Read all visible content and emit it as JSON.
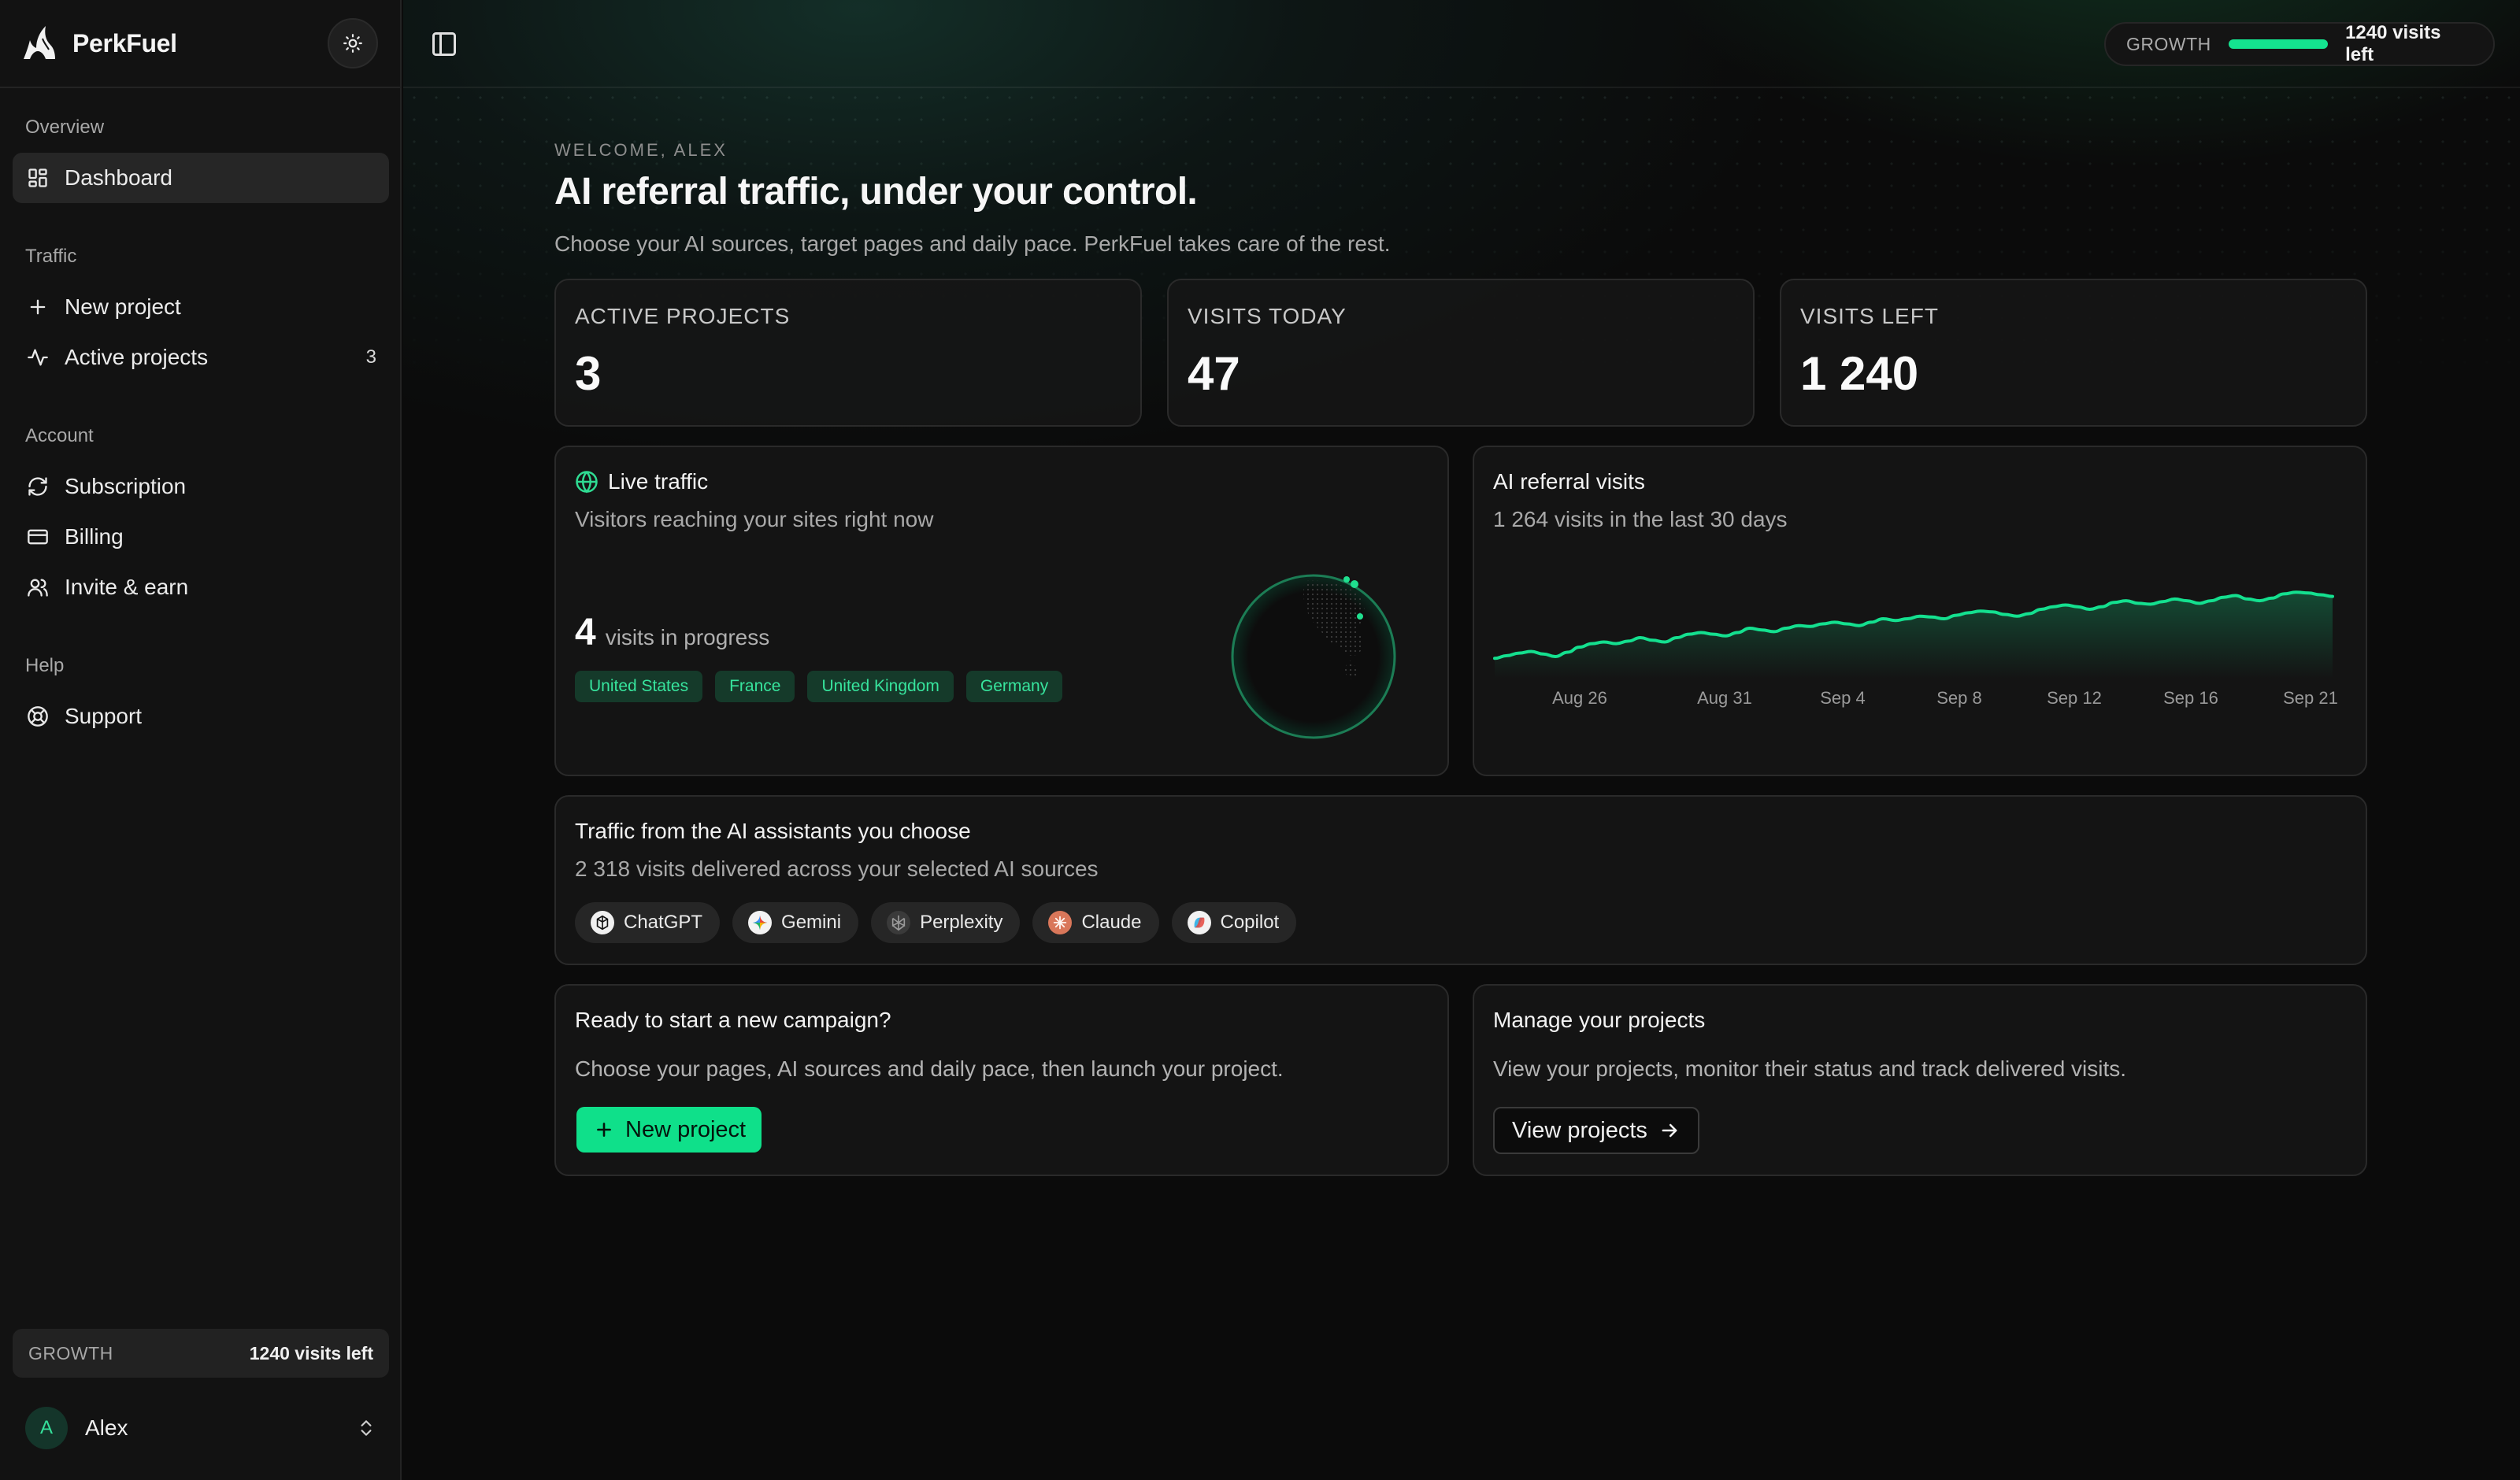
{
  "brand": {
    "name": "PerkFuel"
  },
  "sidebar": {
    "sections": [
      {
        "title": "Overview",
        "items": [
          {
            "label": "Dashboard",
            "icon": "dashboard-icon",
            "active": true
          }
        ]
      },
      {
        "title": "Traffic",
        "items": [
          {
            "label": "New project",
            "icon": "plus-icon"
          },
          {
            "label": "Active projects",
            "icon": "activity-icon",
            "count": "3"
          }
        ]
      },
      {
        "title": "Account",
        "items": [
          {
            "label": "Subscription",
            "icon": "refresh-icon"
          },
          {
            "label": "Billing",
            "icon": "credit-card-icon"
          },
          {
            "label": "Invite & earn",
            "icon": "users-icon"
          }
        ]
      },
      {
        "title": "Help",
        "items": [
          {
            "label": "Support",
            "icon": "lifebuoy-icon"
          }
        ]
      }
    ],
    "plan": {
      "name": "GROWTH",
      "visits_left": "1240 visits left"
    },
    "user": {
      "initial": "A",
      "name": "Alex"
    }
  },
  "topbar": {
    "plan": "GROWTH",
    "visits_left": "1240 visits left",
    "usage_fraction": 1.0
  },
  "welcome": {
    "eyebrow": "WELCOME, ALEX",
    "title": "AI referral traffic, under your control.",
    "subtitle": "Choose your AI sources, target pages and daily pace. PerkFuel takes care of the rest."
  },
  "stats": [
    {
      "label": "ACTIVE PROJECTS",
      "value": "3"
    },
    {
      "label": "VISITS TODAY",
      "value": "47"
    },
    {
      "label": "VISITS LEFT",
      "value": "1 240"
    }
  ],
  "live": {
    "title": "Live traffic",
    "subtitle": "Visitors reaching your sites right now",
    "count": "4",
    "count_label": "visits in progress",
    "countries": [
      "United States",
      "France",
      "United Kingdom",
      "Germany"
    ]
  },
  "referral": {
    "title": "AI referral visits",
    "subtitle": "1 264 visits in the last 30 days"
  },
  "chart_data": {
    "type": "area",
    "x_ticks": [
      "Aug 26",
      "Aug 31",
      "Sep 4",
      "Sep 8",
      "Sep 12",
      "Sep 16",
      "Sep 21"
    ],
    "values": [
      20,
      23,
      26,
      28,
      25,
      22,
      27,
      33,
      37,
      39,
      37,
      40,
      44,
      41,
      39,
      44,
      48,
      50,
      48,
      46,
      50,
      55,
      53,
      51,
      55,
      58,
      57,
      60,
      62,
      60,
      58,
      62,
      66,
      64,
      66,
      69,
      68,
      66,
      70,
      73,
      75,
      74,
      71,
      69,
      72,
      77,
      80,
      82,
      80,
      77,
      80,
      85,
      87,
      84,
      83,
      86,
      89,
      87,
      84,
      87,
      91,
      93,
      89,
      87,
      90,
      95,
      97,
      96,
      94,
      92
    ]
  },
  "assistants": {
    "title": "Traffic from the AI assistants you choose",
    "subtitle": "2 318 visits delivered across your selected AI sources",
    "items": [
      {
        "label": "ChatGPT",
        "icon": "chatgpt-icon",
        "color": "#e8e8e8"
      },
      {
        "label": "Gemini",
        "icon": "gemini-icon",
        "color": "#4f8cf7"
      },
      {
        "label": "Perplexity",
        "icon": "perplexity-icon",
        "color": "#8a8a8a"
      },
      {
        "label": "Claude",
        "icon": "claude-icon",
        "color": "#d9775a"
      },
      {
        "label": "Copilot",
        "icon": "copilot-icon",
        "color": "#3fb6e8"
      }
    ]
  },
  "campaign": {
    "title": "Ready to start a new campaign?",
    "desc": "Choose your pages, AI sources and daily pace, then launch your project.",
    "button": "New project"
  },
  "manage": {
    "title": "Manage your projects",
    "desc": "View your projects, monitor their status and track delivered visits.",
    "button": "View projects"
  },
  "colors": {
    "accent": "#0fe08a",
    "background": "#0b0b0b",
    "card": "#161616"
  }
}
